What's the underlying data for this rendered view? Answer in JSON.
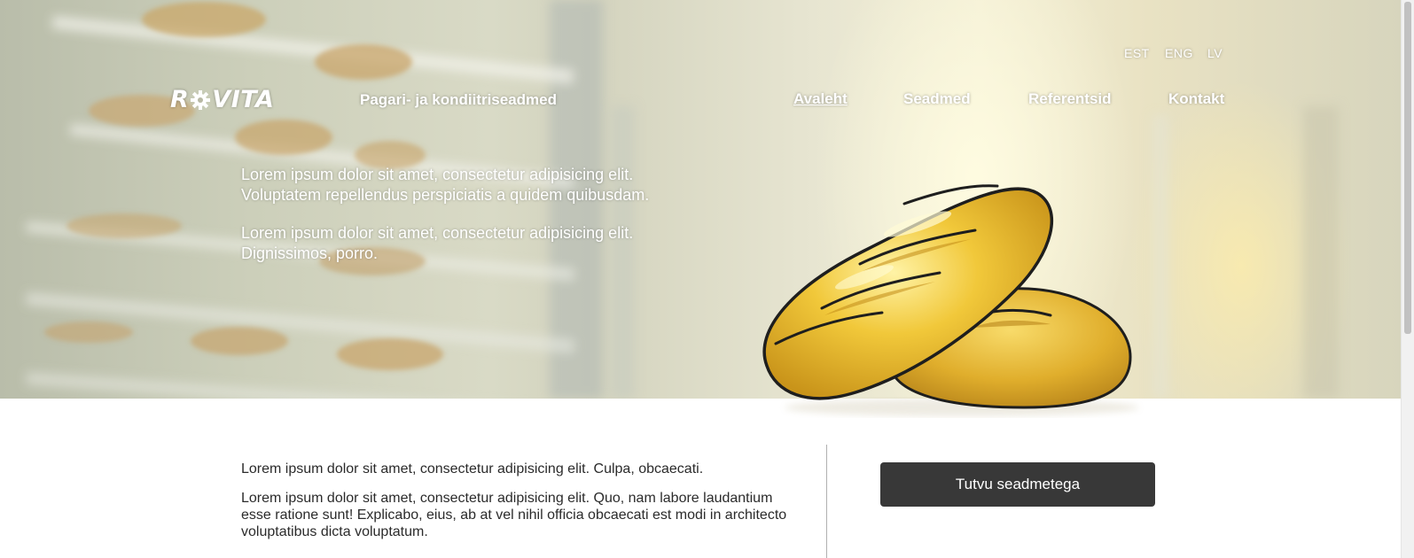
{
  "languages": [
    "EST",
    "ENG",
    "LV"
  ],
  "brand": {
    "logo_text_left": "R",
    "logo_text_right": "VITA",
    "tagline": "Pagari- ja kondiitriseadmed"
  },
  "nav": {
    "items": [
      {
        "label": "Avaleht",
        "active": true
      },
      {
        "label": "Seadmed",
        "active": false
      },
      {
        "label": "Referentsid",
        "active": false
      },
      {
        "label": "Kontakt",
        "active": false
      }
    ]
  },
  "hero": {
    "paragraphs": [
      {
        "line1": "Lorem ipsum dolor sit amet, consectetur adipisicing elit.",
        "line2": "Voluptatem repellendus perspiciatis a quidem quibusdam."
      },
      {
        "line1": "Lorem ipsum dolor sit amet, consectetur adipisicing elit.",
        "line2": "Dignissimos, porro."
      }
    ]
  },
  "content": {
    "paragraphs": [
      "Lorem ipsum dolor sit amet, consectetur adipisicing elit. Culpa, obcaecati.",
      "Lorem ipsum dolor sit amet, consectetur adipisicing elit. Quo, nam labore laudantium esse ratione sunt! Explicabo, eius, ab at vel nihil officia obcaecati est modi in architecto voluptatibus dicta voluptatum."
    ],
    "cta_label": "Tutvu seadmetega"
  },
  "colors": {
    "button_bg": "#383838",
    "bread": "#e8bf2e",
    "text": "#2b2b2b"
  }
}
